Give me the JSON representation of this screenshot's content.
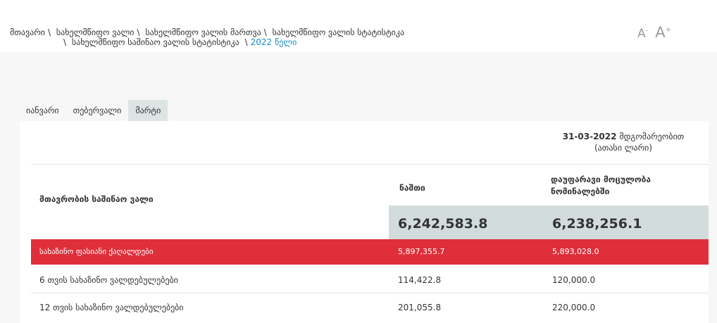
{
  "breadcrumb": {
    "items": [
      "მთავარი",
      "სახელმწიფო ვალი",
      "სახელმწიფო ვალის მართვა",
      "სახელმწიფო ვალის სტატისტიკა",
      "სახელმწიფო საშინაო ვალის სტატისტიკა",
      "2022 წელი"
    ],
    "separator": "\\"
  },
  "font_controls": {
    "decrease": "A",
    "decrease_sup": "-",
    "increase": "A",
    "increase_sup": "+"
  },
  "tabs": [
    {
      "label": "იანვარი",
      "active": false
    },
    {
      "label": "თებერვალი",
      "active": false
    },
    {
      "label": "მარტი",
      "active": true
    }
  ],
  "table": {
    "date_bold": "31-03-2022",
    "date_suffix": "მდგომარეობით",
    "unit": "(ათასი ლარი)",
    "title": "მთავრობის საშინაო ვალი",
    "col1_header": "ნაშთი",
    "col2_header": "დაუფარავი მოცულობა ნომინალებში",
    "total_col1": "6,242,583.8",
    "total_col2": "6,238,256.1",
    "rows": [
      {
        "name": "სახაზინო ფასიანი ქაღალდები",
        "v1": "5,897,355.7",
        "v2": "5,893,028.0",
        "highlight": true
      },
      {
        "name": "6 თვის სახაზინო ვალდებულებები",
        "v1": "114,422.8",
        "v2": "120,000.0",
        "highlight": false
      },
      {
        "name": "12 თვის სახაზინო ვალდებულებები",
        "v1": "201,055.8",
        "v2": "220,000.0",
        "highlight": false
      }
    ]
  },
  "colors": {
    "accent_link": "#1a8cc4",
    "highlight_row": "#df2f3a",
    "total_bg": "#d3dcdc",
    "active_tab_bg": "#dde4e4"
  }
}
